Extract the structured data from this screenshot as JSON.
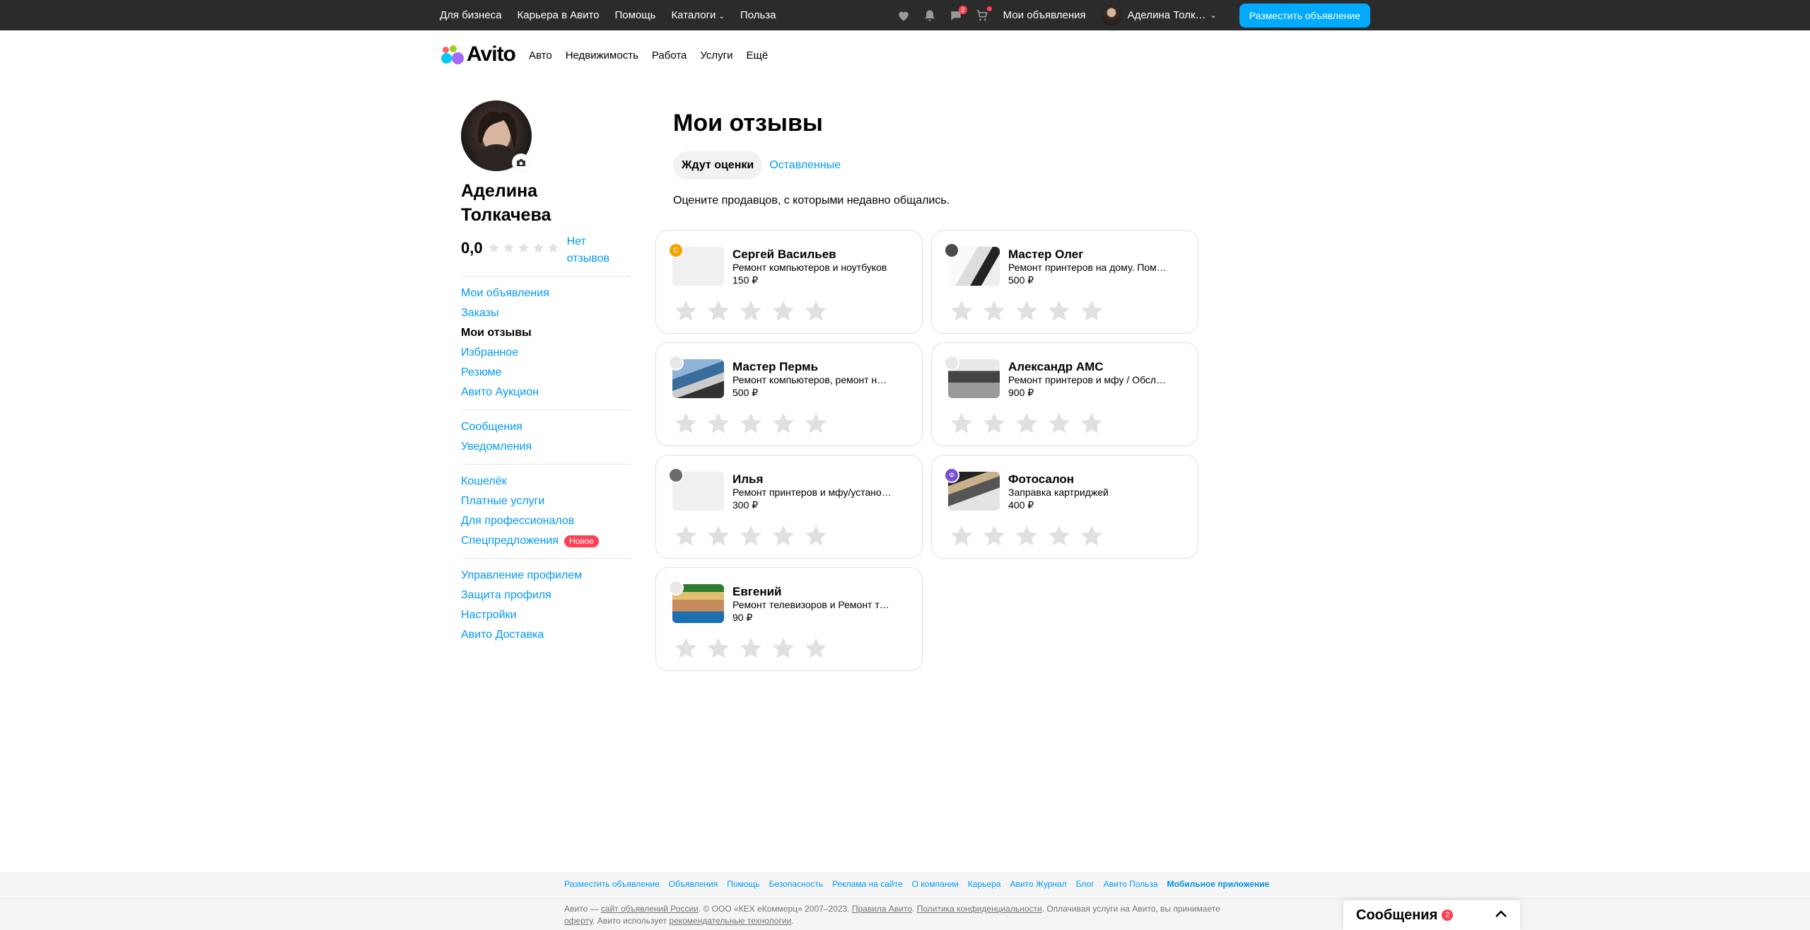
{
  "topbar": {
    "links": [
      "Для бизнеса",
      "Карьера в Авито",
      "Помощь",
      "Каталоги",
      "Польза"
    ],
    "messages_badge": "2",
    "my_ads": "Мои объявления",
    "user_name": "Аделина Толк…",
    "post_button": "Разместить объявление"
  },
  "header": {
    "logo_text": "Avito",
    "nav": [
      "Авто",
      "Недвижимость",
      "Работа",
      "Услуги",
      "Ещё"
    ]
  },
  "profile": {
    "name": "Аделина Толкачева",
    "rating": "0,0",
    "no_reviews": "Нет отзывов"
  },
  "sidebar": {
    "groups": [
      [
        "Мои объявления",
        "Заказы",
        "Мои отзывы",
        "Избранное",
        "Резюме",
        "Авито Аукцион"
      ],
      [
        "Сообщения",
        "Уведомления"
      ],
      [
        "Кошелёк",
        "Платные услуги",
        "Для профессионалов",
        "Спецпредложения"
      ],
      [
        "Управление профилем",
        "Защита профиля",
        "Настройки",
        "Авито Доставка"
      ]
    ],
    "active": "Мои отзывы",
    "new_badge": "Новое"
  },
  "main": {
    "title": "Мои отзывы",
    "tab_active": "Ждут оценки",
    "tab_other": "Оставленные",
    "hint": "Оцените продавцов, с которыми недавно общались."
  },
  "cards": [
    {
      "name": "Сергей Васильев",
      "desc": "Ремонт компьютеров и ноутбуков",
      "price": "150 ₽",
      "avatar_letter": "С",
      "avatar_color": "#f5a300"
    },
    {
      "name": "Мастер Олег",
      "desc": "Ремонт принтеров на дому. Помощь",
      "price": "500 ₽",
      "avatar_letter": "",
      "avatar_color": "#4a4a4a"
    },
    {
      "name": "Мастер Пермь",
      "desc": "Ремонт компьютеров, ремонт ноутбуков",
      "price": "500 ₽",
      "avatar_letter": "",
      "avatar_color": "#e8e8e8"
    },
    {
      "name": "Александр АМС",
      "desc": "Ремонт принтеров и мфу / Обслуживание",
      "price": "900 ₽",
      "avatar_letter": "",
      "avatar_color": "#e8e8e8"
    },
    {
      "name": "Илья",
      "desc": "Ремонт принтеров и мфу/установка",
      "price": "300 ₽",
      "avatar_letter": "",
      "avatar_color": "#6b6b6b"
    },
    {
      "name": "Фотосалон",
      "desc": "Заправка картриджей",
      "price": "400 ₽",
      "avatar_letter": "Ф",
      "avatar_color": "#7a4fd0"
    },
    {
      "name": "Евгений",
      "desc": "Ремонт телевизоров и Ремонт техники",
      "price": "90 ₽",
      "avatar_letter": "",
      "avatar_color": "#e8e8e8"
    }
  ],
  "footer": {
    "links": [
      "Разместить объявление",
      "Объявления",
      "Помощь",
      "Безопасность",
      "Реклама на сайте",
      "О компании",
      "Карьера",
      "Авито Журнал",
      "Блог",
      "Авито Польза",
      "Мобильное приложение"
    ],
    "legal": {
      "p1": "Авито — ",
      "l1": "сайт объявлений России",
      "p2": ". © ООО «КЕХ еКоммерц» 2007–2023. ",
      "l2": "Правила Авито",
      "p3": ". ",
      "l3": "Политика конфиденциальности",
      "p4": ". Оплачивая услуги на Авито, вы принимаете ",
      "l4": "оферту",
      "p5": ". Авито использует ",
      "l5": "рекомендательные технологии",
      "p6": "."
    }
  },
  "messenger": {
    "title": "Сообщения",
    "badge": "2"
  }
}
